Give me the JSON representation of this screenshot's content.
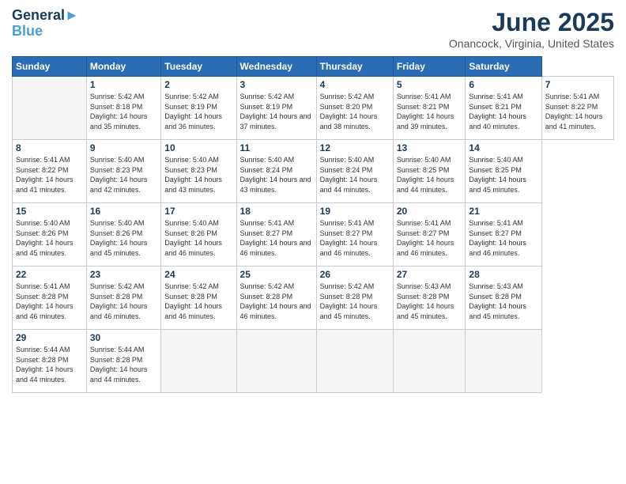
{
  "header": {
    "logo_line1": "General",
    "logo_line2": "Blue",
    "title": "June 2025",
    "subtitle": "Onancock, Virginia, United States"
  },
  "calendar": {
    "days_of_week": [
      "Sunday",
      "Monday",
      "Tuesday",
      "Wednesday",
      "Thursday",
      "Friday",
      "Saturday"
    ],
    "weeks": [
      [
        {
          "num": "",
          "empty": true
        },
        {
          "num": "1",
          "sunrise": "5:42 AM",
          "sunset": "8:18 PM",
          "daylight": "14 hours and 35 minutes."
        },
        {
          "num": "2",
          "sunrise": "5:42 AM",
          "sunset": "8:19 PM",
          "daylight": "14 hours and 36 minutes."
        },
        {
          "num": "3",
          "sunrise": "5:42 AM",
          "sunset": "8:19 PM",
          "daylight": "14 hours and 37 minutes."
        },
        {
          "num": "4",
          "sunrise": "5:42 AM",
          "sunset": "8:20 PM",
          "daylight": "14 hours and 38 minutes."
        },
        {
          "num": "5",
          "sunrise": "5:41 AM",
          "sunset": "8:21 PM",
          "daylight": "14 hours and 39 minutes."
        },
        {
          "num": "6",
          "sunrise": "5:41 AM",
          "sunset": "8:21 PM",
          "daylight": "14 hours and 40 minutes."
        },
        {
          "num": "7",
          "sunrise": "5:41 AM",
          "sunset": "8:22 PM",
          "daylight": "14 hours and 41 minutes."
        }
      ],
      [
        {
          "num": "8",
          "sunrise": "5:41 AM",
          "sunset": "8:22 PM",
          "daylight": "14 hours and 41 minutes."
        },
        {
          "num": "9",
          "sunrise": "5:40 AM",
          "sunset": "8:23 PM",
          "daylight": "14 hours and 42 minutes."
        },
        {
          "num": "10",
          "sunrise": "5:40 AM",
          "sunset": "8:23 PM",
          "daylight": "14 hours and 43 minutes."
        },
        {
          "num": "11",
          "sunrise": "5:40 AM",
          "sunset": "8:24 PM",
          "daylight": "14 hours and 43 minutes."
        },
        {
          "num": "12",
          "sunrise": "5:40 AM",
          "sunset": "8:24 PM",
          "daylight": "14 hours and 44 minutes."
        },
        {
          "num": "13",
          "sunrise": "5:40 AM",
          "sunset": "8:25 PM",
          "daylight": "14 hours and 44 minutes."
        },
        {
          "num": "14",
          "sunrise": "5:40 AM",
          "sunset": "8:25 PM",
          "daylight": "14 hours and 45 minutes."
        }
      ],
      [
        {
          "num": "15",
          "sunrise": "5:40 AM",
          "sunset": "8:26 PM",
          "daylight": "14 hours and 45 minutes."
        },
        {
          "num": "16",
          "sunrise": "5:40 AM",
          "sunset": "8:26 PM",
          "daylight": "14 hours and 45 minutes."
        },
        {
          "num": "17",
          "sunrise": "5:40 AM",
          "sunset": "8:26 PM",
          "daylight": "14 hours and 46 minutes."
        },
        {
          "num": "18",
          "sunrise": "5:41 AM",
          "sunset": "8:27 PM",
          "daylight": "14 hours and 46 minutes."
        },
        {
          "num": "19",
          "sunrise": "5:41 AM",
          "sunset": "8:27 PM",
          "daylight": "14 hours and 46 minutes."
        },
        {
          "num": "20",
          "sunrise": "5:41 AM",
          "sunset": "8:27 PM",
          "daylight": "14 hours and 46 minutes."
        },
        {
          "num": "21",
          "sunrise": "5:41 AM",
          "sunset": "8:27 PM",
          "daylight": "14 hours and 46 minutes."
        }
      ],
      [
        {
          "num": "22",
          "sunrise": "5:41 AM",
          "sunset": "8:28 PM",
          "daylight": "14 hours and 46 minutes."
        },
        {
          "num": "23",
          "sunrise": "5:42 AM",
          "sunset": "8:28 PM",
          "daylight": "14 hours and 46 minutes."
        },
        {
          "num": "24",
          "sunrise": "5:42 AM",
          "sunset": "8:28 PM",
          "daylight": "14 hours and 46 minutes."
        },
        {
          "num": "25",
          "sunrise": "5:42 AM",
          "sunset": "8:28 PM",
          "daylight": "14 hours and 46 minutes."
        },
        {
          "num": "26",
          "sunrise": "5:42 AM",
          "sunset": "8:28 PM",
          "daylight": "14 hours and 45 minutes."
        },
        {
          "num": "27",
          "sunrise": "5:43 AM",
          "sunset": "8:28 PM",
          "daylight": "14 hours and 45 minutes."
        },
        {
          "num": "28",
          "sunrise": "5:43 AM",
          "sunset": "8:28 PM",
          "daylight": "14 hours and 45 minutes."
        }
      ],
      [
        {
          "num": "29",
          "sunrise": "5:44 AM",
          "sunset": "8:28 PM",
          "daylight": "14 hours and 44 minutes."
        },
        {
          "num": "30",
          "sunrise": "5:44 AM",
          "sunset": "8:28 PM",
          "daylight": "14 hours and 44 minutes."
        },
        {
          "num": "",
          "empty": true
        },
        {
          "num": "",
          "empty": true
        },
        {
          "num": "",
          "empty": true
        },
        {
          "num": "",
          "empty": true
        },
        {
          "num": "",
          "empty": true
        }
      ]
    ]
  }
}
